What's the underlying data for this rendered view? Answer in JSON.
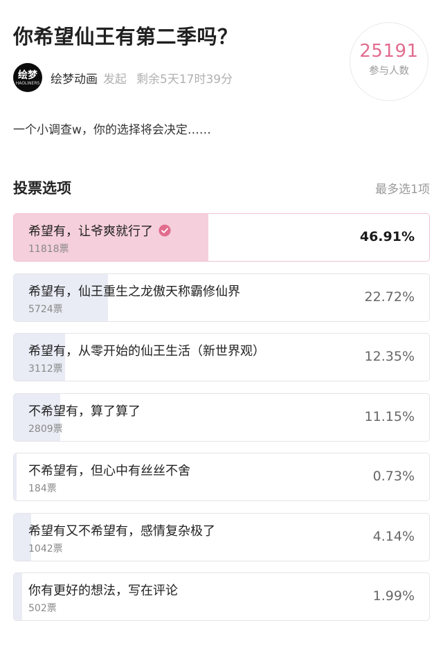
{
  "poll": {
    "title": "你希望仙王有第二季吗？",
    "participants_count": "25191",
    "participants_label": "参与人数",
    "author": {
      "avatar_text_cn": "绘梦",
      "avatar_text_en": "HAOLINERS",
      "name": "绘梦动画",
      "action": "发起",
      "remaining": "剩余5天17时39分"
    },
    "description": "一个小调查w，你的选择将会决定……",
    "section_title": "投票选项",
    "limit_text": "最多选1项"
  },
  "options": [
    {
      "label": "希望有，让爷爽就行了",
      "votes": "11818票",
      "percent": "46.91%",
      "ratio": 0.4691,
      "selected": true
    },
    {
      "label": "希望有，仙王重生之龙傲天称霸修仙界",
      "votes": "5724票",
      "percent": "22.72%",
      "ratio": 0.2272,
      "selected": false
    },
    {
      "label": "希望有，从零开始的仙王生活（新世界观）",
      "votes": "3112票",
      "percent": "12.35%",
      "ratio": 0.1235,
      "selected": false
    },
    {
      "label": "不希望有，算了算了",
      "votes": "2809票",
      "percent": "11.15%",
      "ratio": 0.1115,
      "selected": false
    },
    {
      "label": "不希望有，但心中有丝丝不舍",
      "votes": "184票",
      "percent": "0.73%",
      "ratio": 0.0073,
      "selected": false
    },
    {
      "label": "希望有又不希望有，感情复杂极了",
      "votes": "1042票",
      "percent": "4.14%",
      "ratio": 0.0414,
      "selected": false
    },
    {
      "label": "你有更好的想法，写在评论",
      "votes": "502票",
      "percent": "1.99%",
      "ratio": 0.0199,
      "selected": false
    }
  ],
  "colors": {
    "accent": "#e26c8e",
    "selected_fill": "#f5cfdb",
    "option_fill": "#e9ecf5"
  },
  "icons": {
    "selected_marker": "check-circle-icon"
  }
}
